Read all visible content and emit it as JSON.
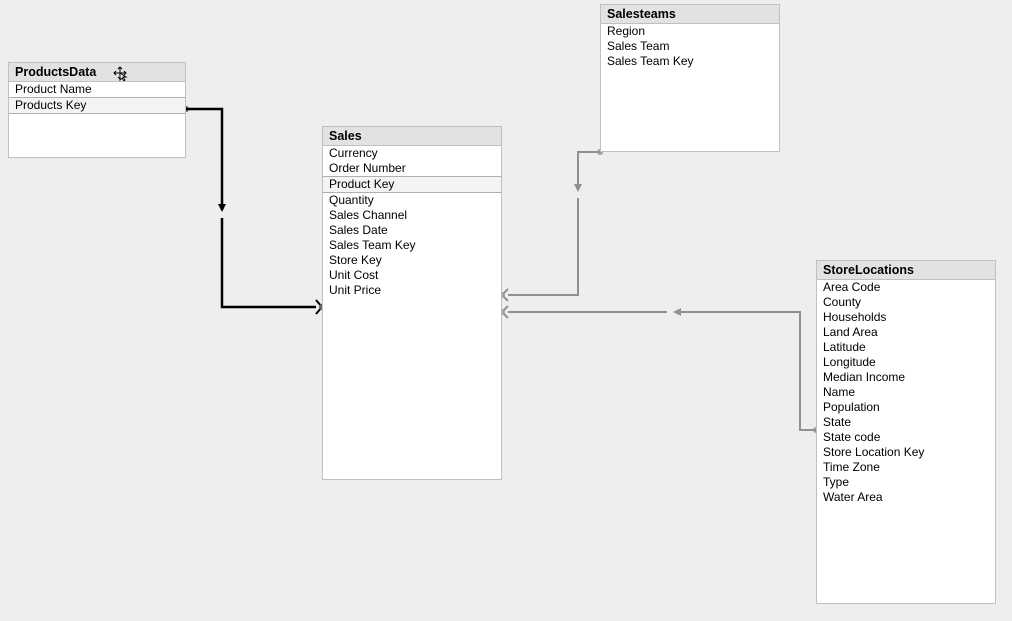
{
  "tables": {
    "products": {
      "title": "ProductsData",
      "fields": [
        "Product Name",
        "Products Key"
      ]
    },
    "sales": {
      "title": "Sales",
      "fields": [
        "Currency",
        "Order Number",
        "Product Key",
        "Quantity",
        "Sales Channel",
        "Sales Date",
        "Sales Team Key",
        "Store Key",
        "Unit Cost",
        "Unit Price"
      ]
    },
    "salesteams": {
      "title": "Salesteams",
      "fields": [
        "Region",
        "Sales Team",
        "Sales Team Key"
      ]
    },
    "storelocations": {
      "title": "StoreLocations",
      "fields": [
        "Area Code",
        "County",
        "Households",
        "Land Area",
        "Latitude",
        "Longitude",
        "Median Income",
        "Name",
        "Population",
        "State",
        "State code",
        "Store Location Key",
        "Time Zone",
        "Type",
        "Water Area"
      ]
    }
  }
}
